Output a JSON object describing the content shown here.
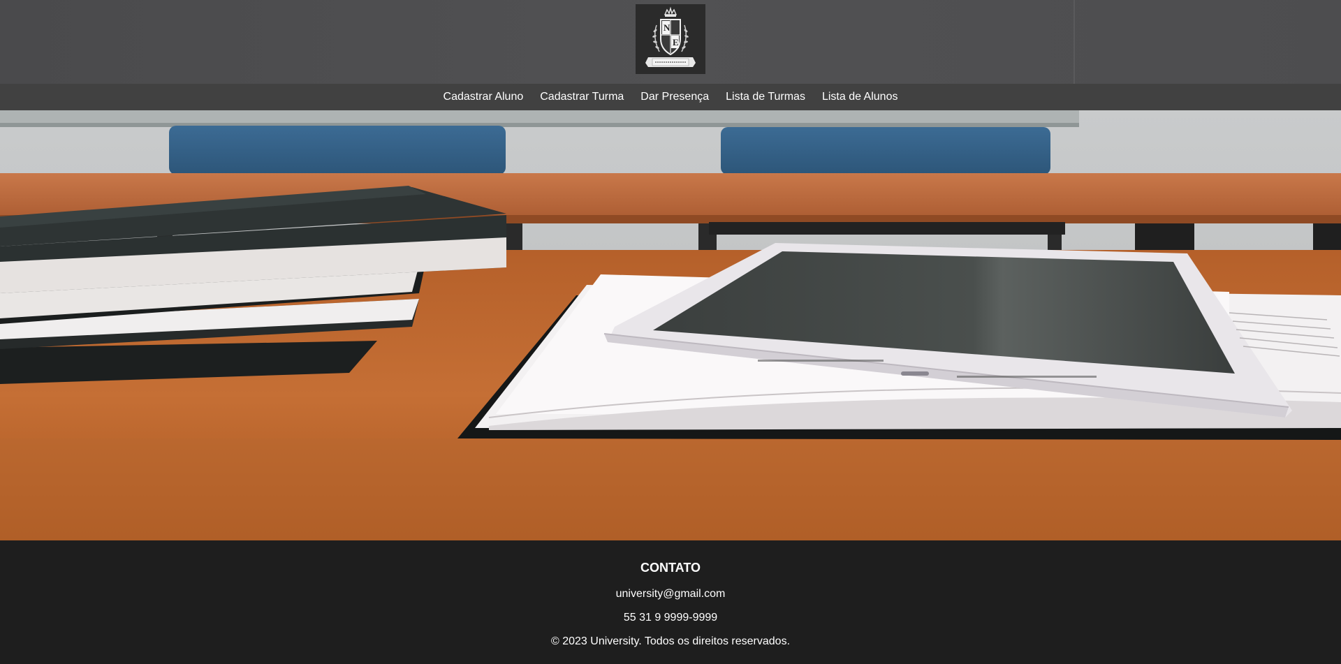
{
  "header": {
    "logo": {
      "icon": "university-crest-logo",
      "letters": [
        "N",
        "E"
      ]
    }
  },
  "nav": {
    "items": [
      {
        "label": "Cadastrar Aluno"
      },
      {
        "label": "Cadastrar Turma"
      },
      {
        "label": "Dar Presença"
      },
      {
        "label": "Lista de Turmas"
      },
      {
        "label": "Lista de Alunos"
      }
    ]
  },
  "hero": {
    "image": "classroom-desk-books-tablet-photo"
  },
  "footer": {
    "title": "CONTATO",
    "email": "university@gmail.com",
    "phone": "55 31 9 9999-9999",
    "copyright": "© 2023 University. Todos os direitos reservados."
  },
  "colors": {
    "header_bg": "#4f4f51",
    "nav_bg": "#414141",
    "footer_bg": "#1e1e1e",
    "text": "#ffffff"
  }
}
